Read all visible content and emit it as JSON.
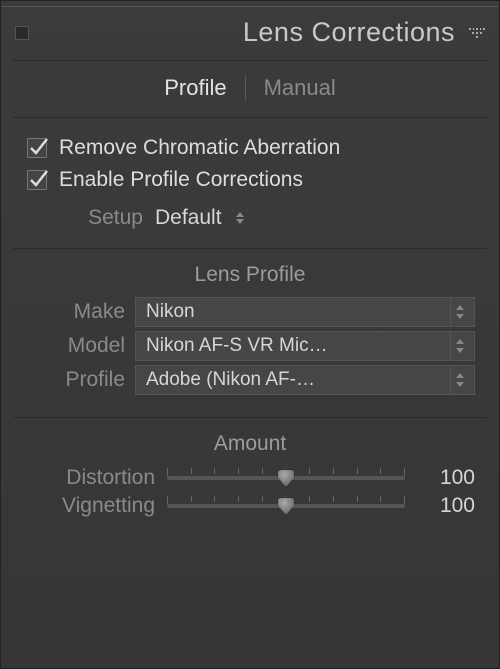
{
  "header": {
    "title": "Lens Corrections"
  },
  "tabs": {
    "profile": "Profile",
    "manual": "Manual",
    "active": "profile"
  },
  "checks": {
    "remove_ca": {
      "label": "Remove Chromatic Aberration",
      "checked": true
    },
    "enable_profile": {
      "label": "Enable Profile Corrections",
      "checked": true
    }
  },
  "setup": {
    "label": "Setup",
    "value": "Default"
  },
  "lens_profile": {
    "title": "Lens Profile",
    "make": {
      "label": "Make",
      "value": "Nikon"
    },
    "model": {
      "label": "Model",
      "value": "Nikon AF-S VR Mic…"
    },
    "profile": {
      "label": "Profile",
      "value": "Adobe (Nikon AF-…"
    }
  },
  "amount": {
    "title": "Amount",
    "distortion": {
      "label": "Distortion",
      "value": "100"
    },
    "vignetting": {
      "label": "Vignetting",
      "value": "100"
    }
  }
}
